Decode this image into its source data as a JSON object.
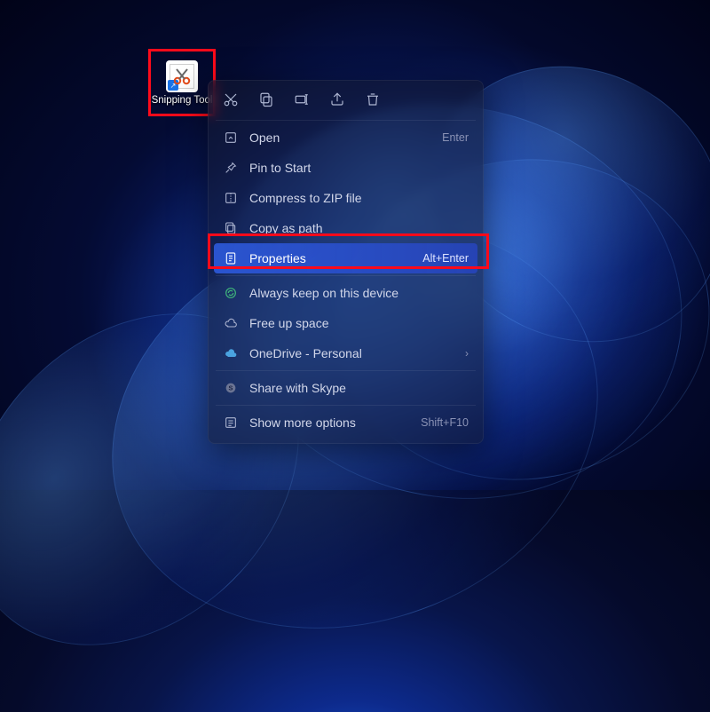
{
  "desktop_icon": {
    "label": "Snipping Tool"
  },
  "toolbar": {
    "cut": "cut",
    "copy": "copy",
    "rename": "rename",
    "share": "share",
    "delete": "delete"
  },
  "menu": {
    "open": {
      "label": "Open",
      "shortcut": "Enter"
    },
    "pin_to_start": {
      "label": "Pin to Start"
    },
    "compress_zip": {
      "label": "Compress to ZIP file"
    },
    "copy_as_path": {
      "label": "Copy as path"
    },
    "properties": {
      "label": "Properties",
      "shortcut": "Alt+Enter"
    },
    "always_keep": {
      "label": "Always keep on this device"
    },
    "free_up": {
      "label": "Free up space"
    },
    "onedrive": {
      "label": "OneDrive - Personal"
    },
    "share_skype": {
      "label": "Share with Skype"
    },
    "more_options": {
      "label": "Show more options",
      "shortcut": "Shift+F10"
    }
  }
}
